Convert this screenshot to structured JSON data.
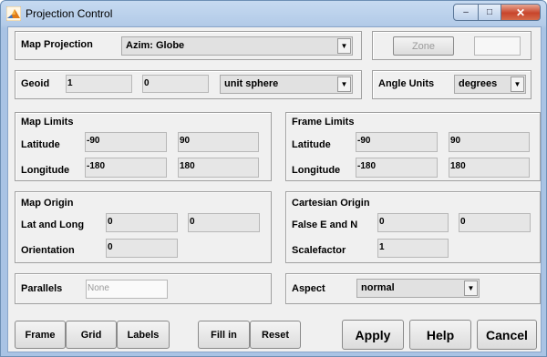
{
  "window": {
    "title": "Projection Control",
    "minimize": "‒",
    "maximize": "□",
    "close": "✕"
  },
  "map_projection": {
    "label": "Map Projection",
    "selected": "Azim: Globe",
    "zone_label": "Zone",
    "zone_value": ""
  },
  "geoid": {
    "label": "Geoid",
    "value1": "1",
    "value2": "0",
    "selected": "unit sphere"
  },
  "angle_units": {
    "label": "Angle Units",
    "selected": "degrees"
  },
  "map_limits": {
    "label": "Map Limits",
    "latitude_label": "Latitude",
    "lat_min": "-90",
    "lat_max": "90",
    "longitude_label": "Longitude",
    "lon_min": "-180",
    "lon_max": "180"
  },
  "frame_limits": {
    "label": "Frame Limits",
    "latitude_label": "Latitude",
    "lat_min": "-90",
    "lat_max": "90",
    "longitude_label": "Longitude",
    "lon_min": "-180",
    "lon_max": "180"
  },
  "map_origin": {
    "label": "Map Origin",
    "latlong_label": "Lat and Long",
    "lat": "0",
    "long": "0",
    "orientation_label": "Orientation",
    "orientation": "0"
  },
  "cartesian_origin": {
    "label": "Cartesian Origin",
    "false_en_label": "False E and N",
    "false_e": "0",
    "false_n": "0",
    "scalefactor_label": "Scalefactor",
    "scalefactor": "1"
  },
  "parallels": {
    "label": "Parallels",
    "placeholder": "None"
  },
  "aspect": {
    "label": "Aspect",
    "selected": "normal"
  },
  "buttons": {
    "frame": "Frame",
    "grid": "Grid",
    "labels": "Labels",
    "fill_in": "Fill in",
    "reset": "Reset",
    "apply": "Apply",
    "help": "Help",
    "cancel": "Cancel"
  },
  "icons": {
    "dropdown": "▼"
  },
  "colors": {
    "titlebar": "#b9d1ea",
    "panel_bg": "#f0f0f0",
    "close_button": "#c8452b"
  }
}
